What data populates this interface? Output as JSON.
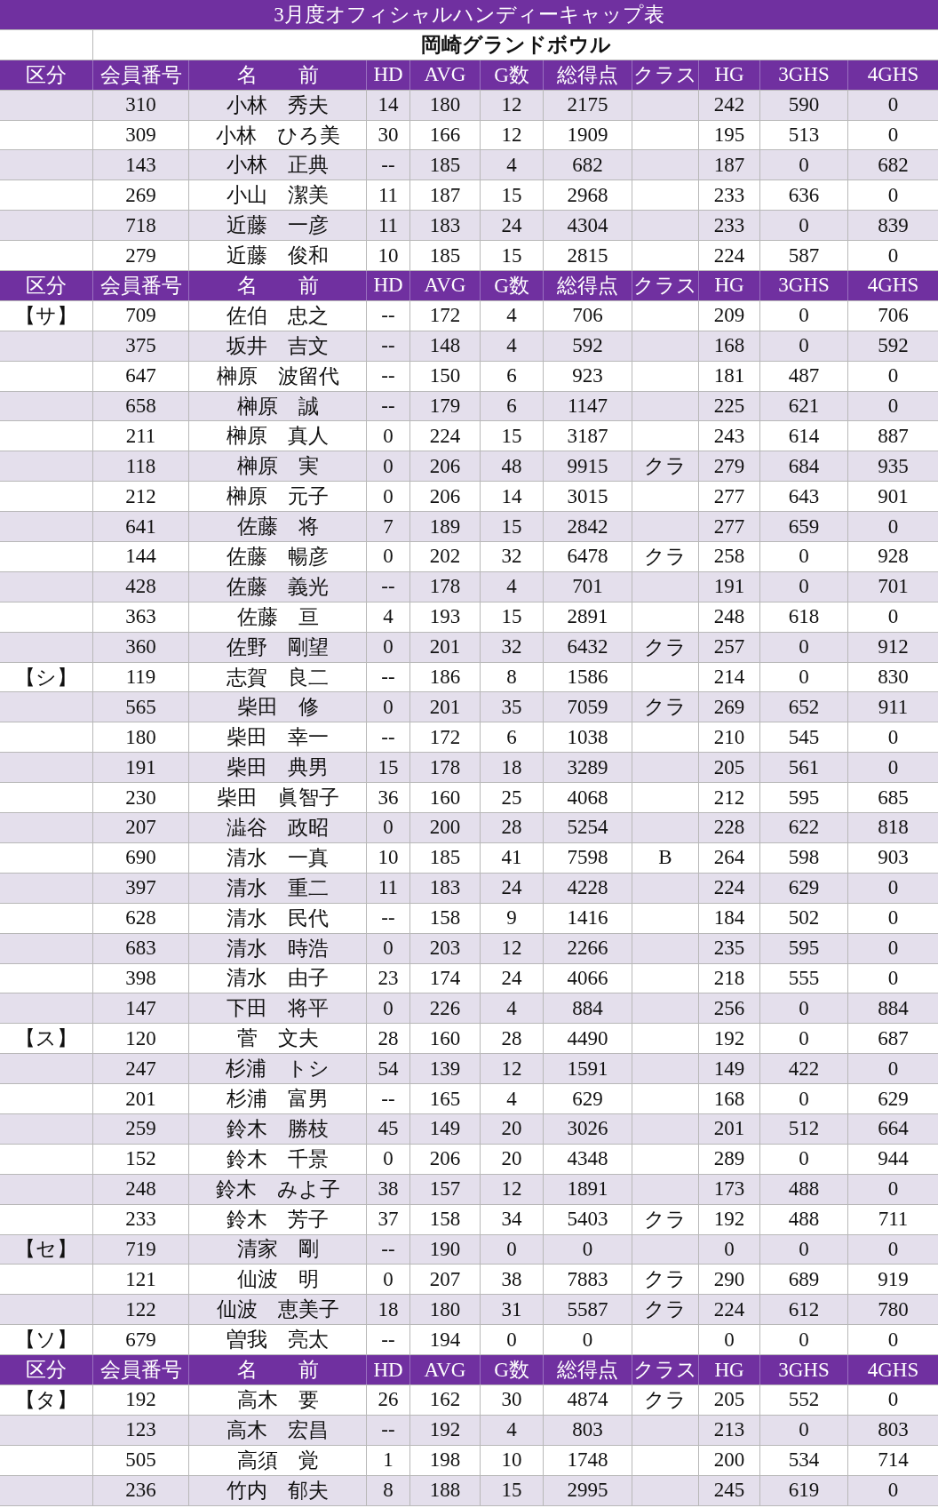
{
  "title": "3月度オフィシャルハンディーキャップ表",
  "subtitle": "岡崎グランドボウル",
  "sections": [
    {
      "columns": [
        "区分",
        "会員番号",
        "名　　前",
        "HD",
        "AVG",
        "G数",
        "総得点",
        "クラス",
        "HG",
        "3GHS",
        "4GHS"
      ],
      "rows": [
        {
          "id": "310",
          "name": "小林　秀夫",
          "hd": "14",
          "avg": "180",
          "games": "12",
          "total": "2175",
          "hg": "242",
          "ghs3": "590",
          "ghs4": "0"
        },
        {
          "id": "309",
          "name": "小林　ひろ美",
          "hd": "30",
          "avg": "166",
          "games": "12",
          "total": "1909",
          "hg": "195",
          "ghs3": "513",
          "ghs4": "0"
        },
        {
          "id": "143",
          "name": "小林　正典",
          "hd": "--",
          "avg": "185",
          "games": "4",
          "total": "682",
          "hg": "187",
          "ghs3": "0",
          "ghs4": "682"
        },
        {
          "id": "269",
          "name": "小山　潔美",
          "hd": "11",
          "avg": "187",
          "games": "15",
          "total": "2968",
          "hg": "233",
          "ghs3": "636",
          "ghs4": "0"
        },
        {
          "id": "718",
          "name": "近藤　一彦",
          "hd": "11",
          "avg": "183",
          "games": "24",
          "total": "4304",
          "hg": "233",
          "ghs3": "0",
          "ghs4": "839"
        },
        {
          "id": "279",
          "name": "近藤　俊和",
          "hd": "10",
          "avg": "185",
          "games": "15",
          "total": "2815",
          "hg": "224",
          "ghs3": "587",
          "ghs4": "0"
        }
      ]
    },
    {
      "columns": [
        "区分",
        "会員番号",
        "名　　前",
        "HD",
        "AVG",
        "G数",
        "総得点",
        "クラス",
        "HG",
        "3GHS",
        "4GHS"
      ],
      "rows": [
        {
          "group": "【サ】",
          "id": "709",
          "name": "佐伯　忠之",
          "hd": "--",
          "avg": "172",
          "games": "4",
          "total": "706",
          "hg": "209",
          "ghs3": "0",
          "ghs4": "706"
        },
        {
          "id": "375",
          "name": "坂井　吉文",
          "hd": "--",
          "avg": "148",
          "games": "4",
          "total": "592",
          "hg": "168",
          "ghs3": "0",
          "ghs4": "592"
        },
        {
          "id": "647",
          "name": "榊原　波留代",
          "hd": "--",
          "avg": "150",
          "games": "6",
          "total": "923",
          "hg": "181",
          "ghs3": "487",
          "ghs4": "0"
        },
        {
          "id": "658",
          "name": "榊原　誠",
          "hd": "--",
          "avg": "179",
          "games": "6",
          "total": "1147",
          "hg": "225",
          "ghs3": "621",
          "ghs4": "0"
        },
        {
          "id": "211",
          "name": "榊原　真人",
          "hd": "0",
          "avg": "224",
          "games": "15",
          "total": "3187",
          "hg": "243",
          "ghs3": "614",
          "ghs4": "887"
        },
        {
          "id": "118",
          "name": "榊原　実",
          "hd": "0",
          "avg": "206",
          "games": "48",
          "total": "9915",
          "class": "クラ",
          "hg": "279",
          "ghs3": "684",
          "ghs4": "935"
        },
        {
          "id": "212",
          "name": "榊原　元子",
          "hd": "0",
          "avg": "206",
          "games": "14",
          "total": "3015",
          "hg": "277",
          "ghs3": "643",
          "ghs4": "901"
        },
        {
          "id": "641",
          "name": "佐藤　将",
          "hd": "7",
          "avg": "189",
          "games": "15",
          "total": "2842",
          "hg": "277",
          "ghs3": "659",
          "ghs4": "0"
        },
        {
          "id": "144",
          "name": "佐藤　暢彦",
          "hd": "0",
          "avg": "202",
          "games": "32",
          "total": "6478",
          "class": "クラ",
          "hg": "258",
          "ghs3": "0",
          "ghs4": "928"
        },
        {
          "id": "428",
          "name": "佐藤　義光",
          "hd": "--",
          "avg": "178",
          "games": "4",
          "total": "701",
          "hg": "191",
          "ghs3": "0",
          "ghs4": "701"
        },
        {
          "id": "363",
          "name": "佐藤　亘",
          "hd": "4",
          "avg": "193",
          "games": "15",
          "total": "2891",
          "hg": "248",
          "ghs3": "618",
          "ghs4": "0"
        },
        {
          "id": "360",
          "name": "佐野　剛望",
          "hd": "0",
          "avg": "201",
          "games": "32",
          "total": "6432",
          "class": "クラ",
          "hg": "257",
          "ghs3": "0",
          "ghs4": "912"
        },
        {
          "group": "【シ】",
          "id": "119",
          "name": "志賀　良二",
          "hd": "--",
          "avg": "186",
          "games": "8",
          "total": "1586",
          "hg": "214",
          "ghs3": "0",
          "ghs4": "830"
        },
        {
          "id": "565",
          "name": "柴田　修",
          "hd": "0",
          "avg": "201",
          "games": "35",
          "total": "7059",
          "class": "クラ",
          "hg": "269",
          "ghs3": "652",
          "ghs4": "911"
        },
        {
          "id": "180",
          "name": "柴田　幸一",
          "hd": "--",
          "avg": "172",
          "games": "6",
          "total": "1038",
          "hg": "210",
          "ghs3": "545",
          "ghs4": "0"
        },
        {
          "id": "191",
          "name": "柴田　典男",
          "hd": "15",
          "avg": "178",
          "games": "18",
          "total": "3289",
          "hg": "205",
          "ghs3": "561",
          "ghs4": "0"
        },
        {
          "id": "230",
          "name": "柴田　眞智子",
          "hd": "36",
          "avg": "160",
          "games": "25",
          "total": "4068",
          "hg": "212",
          "ghs3": "595",
          "ghs4": "685"
        },
        {
          "id": "207",
          "name": "澁谷　政昭",
          "hd": "0",
          "avg": "200",
          "games": "28",
          "total": "5254",
          "hg": "228",
          "ghs3": "622",
          "ghs4": "818"
        },
        {
          "id": "690",
          "name": "清水　一真",
          "hd": "10",
          "avg": "185",
          "games": "41",
          "total": "7598",
          "class": "B",
          "hg": "264",
          "ghs3": "598",
          "ghs4": "903"
        },
        {
          "id": "397",
          "name": "清水　重二",
          "hd": "11",
          "avg": "183",
          "games": "24",
          "total": "4228",
          "hg": "224",
          "ghs3": "629",
          "ghs4": "0"
        },
        {
          "id": "628",
          "name": "清水　民代",
          "hd": "--",
          "avg": "158",
          "games": "9",
          "total": "1416",
          "hg": "184",
          "ghs3": "502",
          "ghs4": "0"
        },
        {
          "id": "683",
          "name": "清水　時浩",
          "hd": "0",
          "avg": "203",
          "games": "12",
          "total": "2266",
          "hg": "235",
          "ghs3": "595",
          "ghs4": "0"
        },
        {
          "id": "398",
          "name": "清水　由子",
          "hd": "23",
          "avg": "174",
          "games": "24",
          "total": "4066",
          "hg": "218",
          "ghs3": "555",
          "ghs4": "0"
        },
        {
          "id": "147",
          "name": "下田　将平",
          "hd": "0",
          "avg": "226",
          "games": "4",
          "total": "884",
          "hg": "256",
          "ghs3": "0",
          "ghs4": "884"
        },
        {
          "group": "【ス】",
          "id": "120",
          "name": "菅　文夫",
          "hd": "28",
          "avg": "160",
          "games": "28",
          "total": "4490",
          "hg": "192",
          "ghs3": "0",
          "ghs4": "687"
        },
        {
          "id": "247",
          "name": "杉浦　トシ",
          "hd": "54",
          "avg": "139",
          "games": "12",
          "total": "1591",
          "hg": "149",
          "ghs3": "422",
          "ghs4": "0"
        },
        {
          "id": "201",
          "name": "杉浦　富男",
          "hd": "--",
          "avg": "165",
          "games": "4",
          "total": "629",
          "hg": "168",
          "ghs3": "0",
          "ghs4": "629"
        },
        {
          "id": "259",
          "name": "鈴木　勝枝",
          "hd": "45",
          "avg": "149",
          "games": "20",
          "total": "3026",
          "hg": "201",
          "ghs3": "512",
          "ghs4": "664"
        },
        {
          "id": "152",
          "name": "鈴木　千景",
          "hd": "0",
          "avg": "206",
          "games": "20",
          "total": "4348",
          "hg": "289",
          "ghs3": "0",
          "ghs4": "944"
        },
        {
          "id": "248",
          "name": "鈴木　みよ子",
          "hd": "38",
          "avg": "157",
          "games": "12",
          "total": "1891",
          "hg": "173",
          "ghs3": "488",
          "ghs4": "0"
        },
        {
          "id": "233",
          "name": "鈴木　芳子",
          "hd": "37",
          "avg": "158",
          "games": "34",
          "total": "5403",
          "class": "クラ",
          "hg": "192",
          "ghs3": "488",
          "ghs4": "711"
        },
        {
          "group": "【セ】",
          "id": "719",
          "name": "清家　剛",
          "hd": "--",
          "avg": "190",
          "games": "0",
          "total": "0",
          "hg": "0",
          "ghs3": "0",
          "ghs4": "0"
        },
        {
          "id": "121",
          "name": "仙波　明",
          "hd": "0",
          "avg": "207",
          "games": "38",
          "total": "7883",
          "class": "クラ",
          "hg": "290",
          "ghs3": "689",
          "ghs4": "919"
        },
        {
          "id": "122",
          "name": "仙波　恵美子",
          "hd": "18",
          "avg": "180",
          "games": "31",
          "total": "5587",
          "class": "クラ",
          "hg": "224",
          "ghs3": "612",
          "ghs4": "780"
        },
        {
          "group": "【ソ】",
          "id": "679",
          "name": "曽我　亮太",
          "hd": "--",
          "avg": "194",
          "games": "0",
          "total": "0",
          "hg": "0",
          "ghs3": "0",
          "ghs4": "0"
        }
      ]
    },
    {
      "columns": [
        "区分",
        "会員番号",
        "名　　前",
        "HD",
        "AVG",
        "G数",
        "総得点",
        "クラス",
        "HG",
        "3GHS",
        "4GHS"
      ],
      "rows": [
        {
          "group": "【タ】",
          "id": "192",
          "name": "高木　要",
          "hd": "26",
          "avg": "162",
          "games": "30",
          "total": "4874",
          "class": "クラ",
          "hg": "205",
          "ghs3": "552",
          "ghs4": "0"
        },
        {
          "id": "123",
          "name": "高木　宏昌",
          "hd": "--",
          "avg": "192",
          "games": "4",
          "total": "803",
          "hg": "213",
          "ghs3": "0",
          "ghs4": "803"
        },
        {
          "id": "505",
          "name": "高須　覚",
          "hd": "1",
          "avg": "198",
          "games": "10",
          "total": "1748",
          "hg": "200",
          "ghs3": "534",
          "ghs4": "714"
        },
        {
          "id": "236",
          "name": "竹内　郁夫",
          "hd": "8",
          "avg": "188",
          "games": "15",
          "total": "2995",
          "hg": "245",
          "ghs3": "619",
          "ghs4": "0"
        }
      ]
    }
  ]
}
